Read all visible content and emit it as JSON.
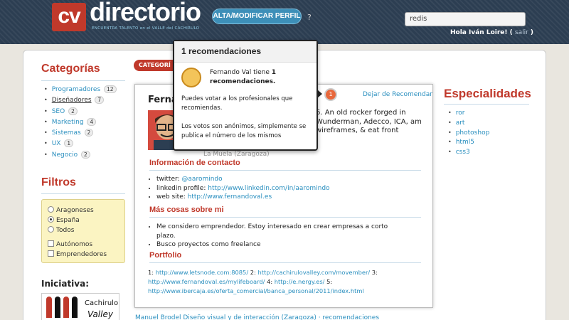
{
  "header": {
    "logo_cv": "cv",
    "logo_text": "directorio",
    "tagline": "ENCUENTRA TALENTO en el VALLE del CACHIRULO",
    "alta_button": "ALTA/MODIFICAR PERFIL",
    "help": "?",
    "search_value": "redis",
    "greeting": "Hola Iván Loire! (",
    "logout": "salir",
    "greeting_close": ")"
  },
  "sidebar": {
    "categorias_title": "Categorías",
    "categorias": [
      {
        "label": "Programadores",
        "count": "12"
      },
      {
        "label": "Diseñadores",
        "count": "7"
      },
      {
        "label": "SEO",
        "count": "2"
      },
      {
        "label": "Marketing",
        "count": "4"
      },
      {
        "label": "Sistemas",
        "count": "2"
      },
      {
        "label": "UX",
        "count": "1"
      },
      {
        "label": "Negocio",
        "count": "2"
      }
    ],
    "filtros_title": "Filtros",
    "filtros": {
      "radios": [
        "Aragoneses",
        "España",
        "Todos"
      ],
      "selected": "España",
      "checks": [
        "Autónomos",
        "Emprendedores"
      ]
    },
    "iniciativa_title": "Iniciativa:",
    "cachirulo_line1": "Cachirulo",
    "cachirulo_line2": "Valley"
  },
  "main": {
    "category_tab": "CATEGORÍ",
    "profile": {
      "name": "Ferna",
      "description": "6. An old rocker forged in Wunderman, Adecco, ICA, am wireframes, & eat front",
      "location": "La Muela (Zaragoza)",
      "unrecommend": "Dejar de Recomendar",
      "rec_count": "1",
      "contact_title": "Información de contacto",
      "contact": [
        {
          "label": "twitter: ",
          "value": "@aaromindo"
        },
        {
          "label": "linkedin profile: ",
          "value": "http://www.linkedin.com/in/aaromindo"
        },
        {
          "label": "web site: ",
          "value": "http://www.fernandoval.es"
        }
      ],
      "mas_title": "Más cosas sobre mi",
      "mas": [
        "Me considero emprendedor. Estoy interesado en crear empresas a corto plazo.",
        "Busco proyectos como freelance"
      ],
      "portfolio_title": "Portfolio",
      "portfolio": [
        {
          "n": "1: ",
          "url": "http://www.letsnode.com:8085/"
        },
        {
          "n": " 2: ",
          "url": "http://cachirulovalley.com/movember/"
        },
        {
          "n": " 3: ",
          "url": "http://www.fernandoval.es/mylifeboard/"
        },
        {
          "n": " 4: ",
          "url": "http://e.nergy.es/"
        },
        {
          "n": " 5: ",
          "url": "http://www.ibercaja.es/oferta_comercial/banca_personal/2011/index.html"
        }
      ]
    },
    "next_row": "Manuel Brodel Diseño visual y de interacción (Zaragoza) · recomendaciones"
  },
  "popup": {
    "title": "1 recomendaciones",
    "line1_a": "Fernando Val tiene ",
    "line1_b": "1 recomendaciones.",
    "body1": "Puedes votar a los profesionales que recomiendas.",
    "body2": "Los votos son anónimos, simplemente se publica el número de los mismos"
  },
  "especialidades": {
    "title": "Especialidades",
    "items": [
      "ror",
      "art",
      "photoshop",
      "html5",
      "css3"
    ]
  },
  "colors": {
    "accent": "#c0392b",
    "link": "#2a8fbf",
    "header": "#2c3e52"
  }
}
